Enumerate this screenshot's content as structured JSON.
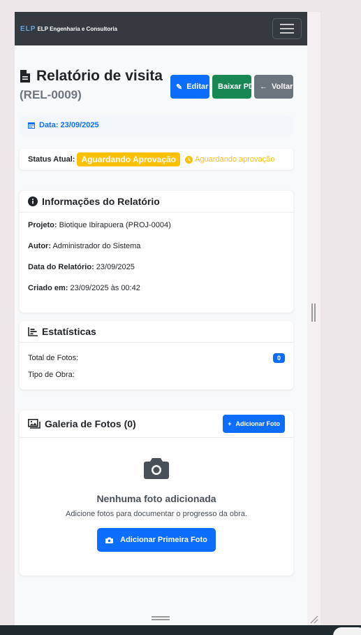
{
  "navbar": {
    "logo_mark": "ELP",
    "brand": "ELP Engenharia e Consultoria"
  },
  "header": {
    "title": "Relatório de visita",
    "subtitle": "(REL-0009)"
  },
  "actions": {
    "edit": "Editar",
    "download": "Baixar PDF",
    "back": "Voltar"
  },
  "date": {
    "label": "Data: 23/09/2025"
  },
  "status": {
    "label": "Status Atual:",
    "badge": "Aguardando Aprovação",
    "note": "Aguardando aprovação"
  },
  "info": {
    "title": "Informações do Relatório",
    "project_label": "Projeto:",
    "project_value": "Biotique Ibirapuera (PROJ-0004)",
    "author_label": "Autor:",
    "author_value": "Administrador do Sistema",
    "date_label": "Data do Relatório:",
    "date_value": "23/09/2025",
    "created_label": "Criado em:",
    "created_value": "23/09/2025 às 00:42"
  },
  "stats": {
    "title": "Estatísticas",
    "photos_label": "Total de Fotos:",
    "photos_count": "0",
    "work_type_label": "Tipo de Obra:"
  },
  "gallery": {
    "title": "Galeria de Fotos (0)",
    "add_button": "Adicionar Foto",
    "empty_title": "Nenhuma foto adicionada",
    "empty_text": "Adicione fotos para documentar o progresso da obra.",
    "first_button": "Adicionar Primeira Foto"
  },
  "colors": {
    "primary": "#0d6efd",
    "success": "#198754",
    "secondary": "#6c757d",
    "warning": "#ffc107",
    "navbar": "#343a40"
  }
}
